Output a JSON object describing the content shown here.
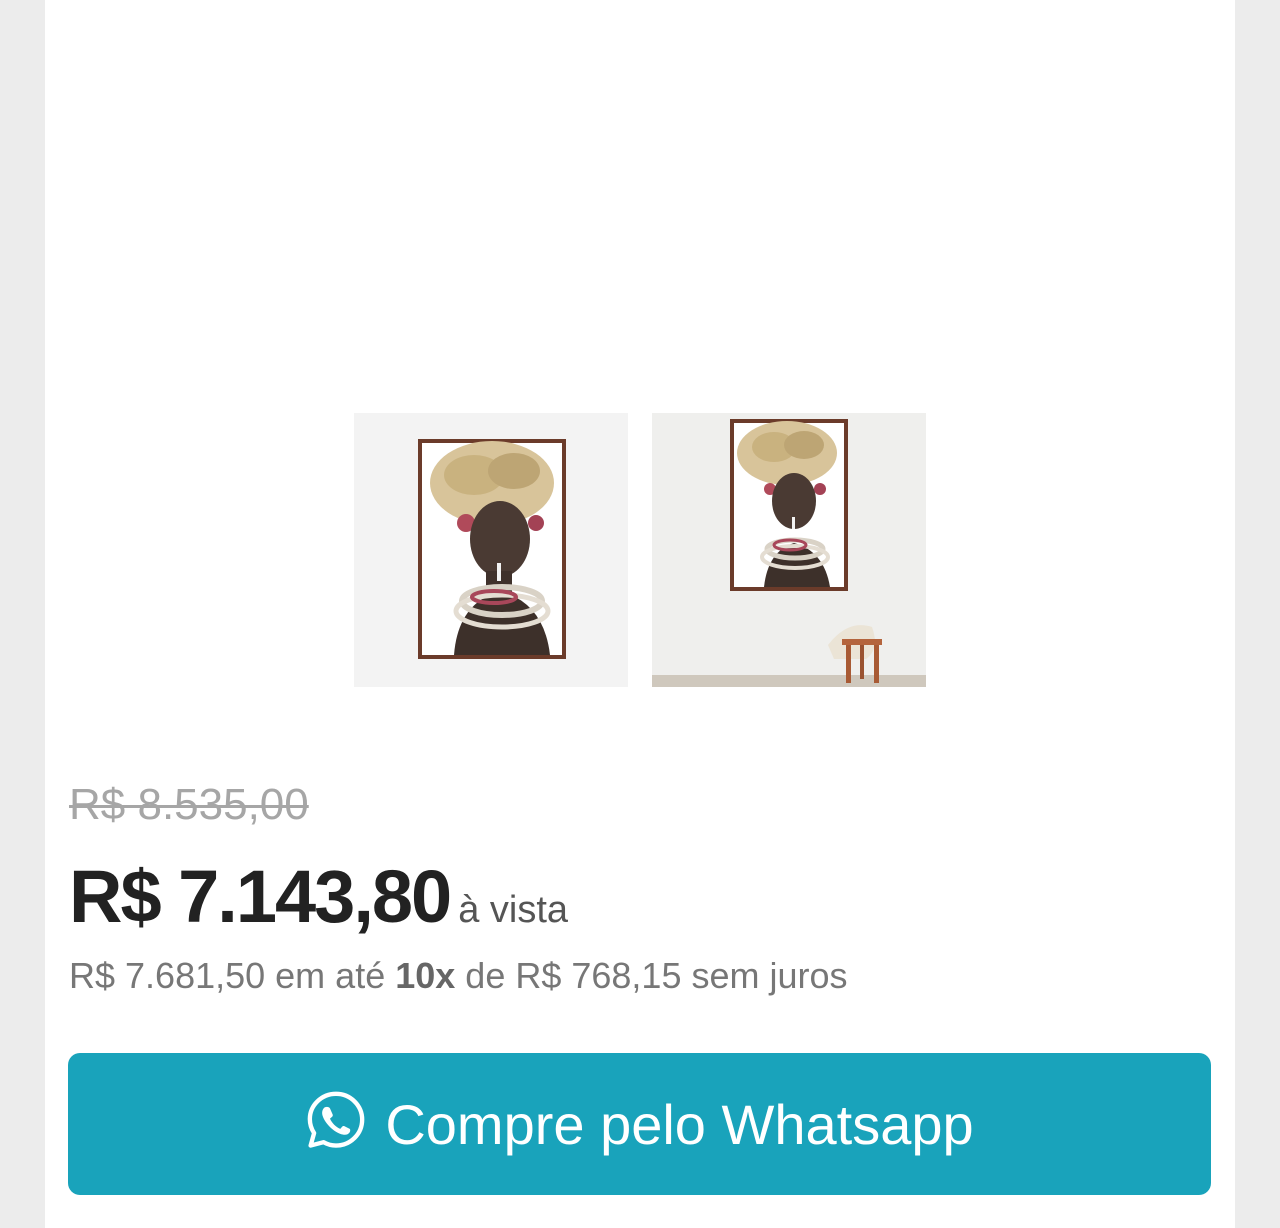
{
  "product": {
    "thumbnails": [
      {
        "name": "framed-portrait-front"
      },
      {
        "name": "framed-portrait-room"
      }
    ],
    "old_price": "R$ 8.535,00",
    "price": "R$ 7.143,80",
    "price_suffix": "à vista",
    "installments": {
      "prefix": "R$ 7.681,50 em até ",
      "count": "10x",
      "suffix": " de R$ 768,15 sem juros"
    }
  },
  "cta": {
    "label": "Compre pelo Whatsapp",
    "icon": "whatsapp-icon",
    "color": "#19a3bb"
  }
}
